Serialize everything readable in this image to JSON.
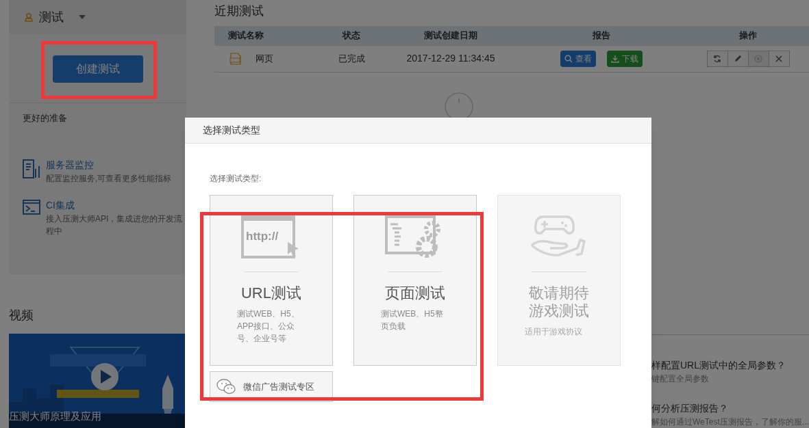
{
  "sidebar": {
    "project": "测试",
    "create_button": "创建测试",
    "section_title": "更好的准备",
    "items": [
      {
        "kind": "monitor",
        "title": "服务器监控",
        "desc": "配置监控服务,可查看更多性能指标"
      },
      {
        "kind": "terminal",
        "title": "CI集成",
        "desc": "接入压测大师API，集成进您的开发流程中"
      }
    ],
    "video_heading": "视频",
    "video_caption": "压测大师原理及应用"
  },
  "main": {
    "title": "近期测试",
    "table": {
      "columns": [
        "测试名称",
        "状态",
        "测试创建日期",
        "报告",
        "操作"
      ],
      "rows": [
        {
          "name": "网页",
          "status": "已完成",
          "date": "2017-12-29 11:34:45",
          "view_button": "查看",
          "download_button": "下载",
          "actions": [
            {
              "kind": "refresh",
              "disabled": false
            },
            {
              "kind": "edit",
              "disabled": false
            },
            {
              "kind": "stop",
              "disabled": true
            },
            {
              "kind": "delete",
              "disabled": false
            }
          ]
        }
      ]
    },
    "faq": [
      {
        "title": "样配置URL测试中的全局参数？",
        "desc": "键配置全局参数"
      },
      {
        "title": "何分析压测报告？",
        "desc": "解如何通过WeTest压测报告，了解你的服..."
      }
    ]
  },
  "modal": {
    "title": "选择测试类型",
    "prompt": "选择测试类型:",
    "cards": [
      {
        "kind": "url",
        "icon_text": "http://",
        "title": "URL测试",
        "desc": "测试WEB、H5、APP接口、公众号、企业号等",
        "disabled": false
      },
      {
        "kind": "page",
        "title": "页面测试",
        "desc": "测试WEB、H5整页负载",
        "disabled": false
      },
      {
        "kind": "game",
        "title": "敬请期待游戏测试",
        "desc": "适用于游戏协议",
        "disabled": true
      }
    ],
    "wechat_button": "微信广告测试专区"
  }
}
